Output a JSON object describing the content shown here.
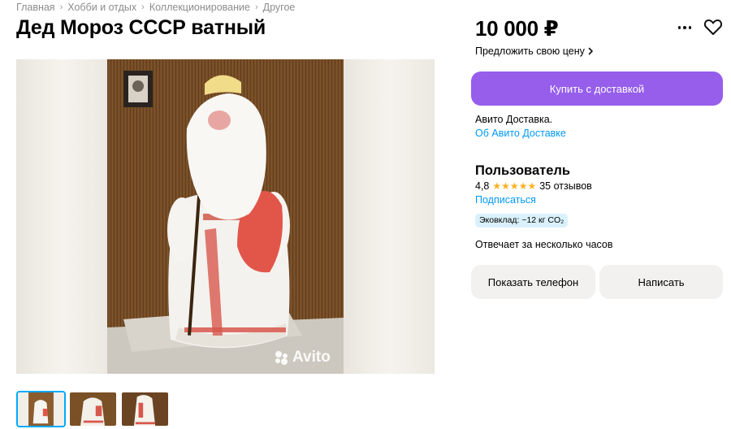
{
  "breadcrumbs": [
    "Главная",
    "Хобби и отдых",
    "Коллекционирование",
    "Другое"
  ],
  "title": "Дед Мороз СССР ватный",
  "gallery": {
    "watermark": "Avito",
    "thumbnail_count": 3,
    "active_thumbnail": 1
  },
  "price": "10 000 ₽",
  "offer_price_label": "Предложить свою цену",
  "buy_button": "Купить с доставкой",
  "delivery": {
    "text": "Авито Доставка.",
    "link": "Об Авито Доставке"
  },
  "seller": {
    "name": "Пользователь",
    "rating": "4,8",
    "stars": 5,
    "reviews": "35 отзывов",
    "subscribe": "Подписаться",
    "eco_badge": "Эковклад: ~12 кг CO₂",
    "response_time": "Отвечает за несколько часов"
  },
  "actions": {
    "show_phone": "Показать телефон",
    "write": "Написать"
  },
  "colors": {
    "accent_purple": "#965eeb",
    "link_blue": "#0099f7",
    "star_yellow": "#ffb021",
    "thumbnail_border": "#00aaff",
    "eco_badge_bg": "#d9f1fb"
  },
  "icons": [
    "chevron-right-icon",
    "more-dots-icon",
    "heart-icon",
    "star-icon",
    "avito-logo-icon"
  ]
}
